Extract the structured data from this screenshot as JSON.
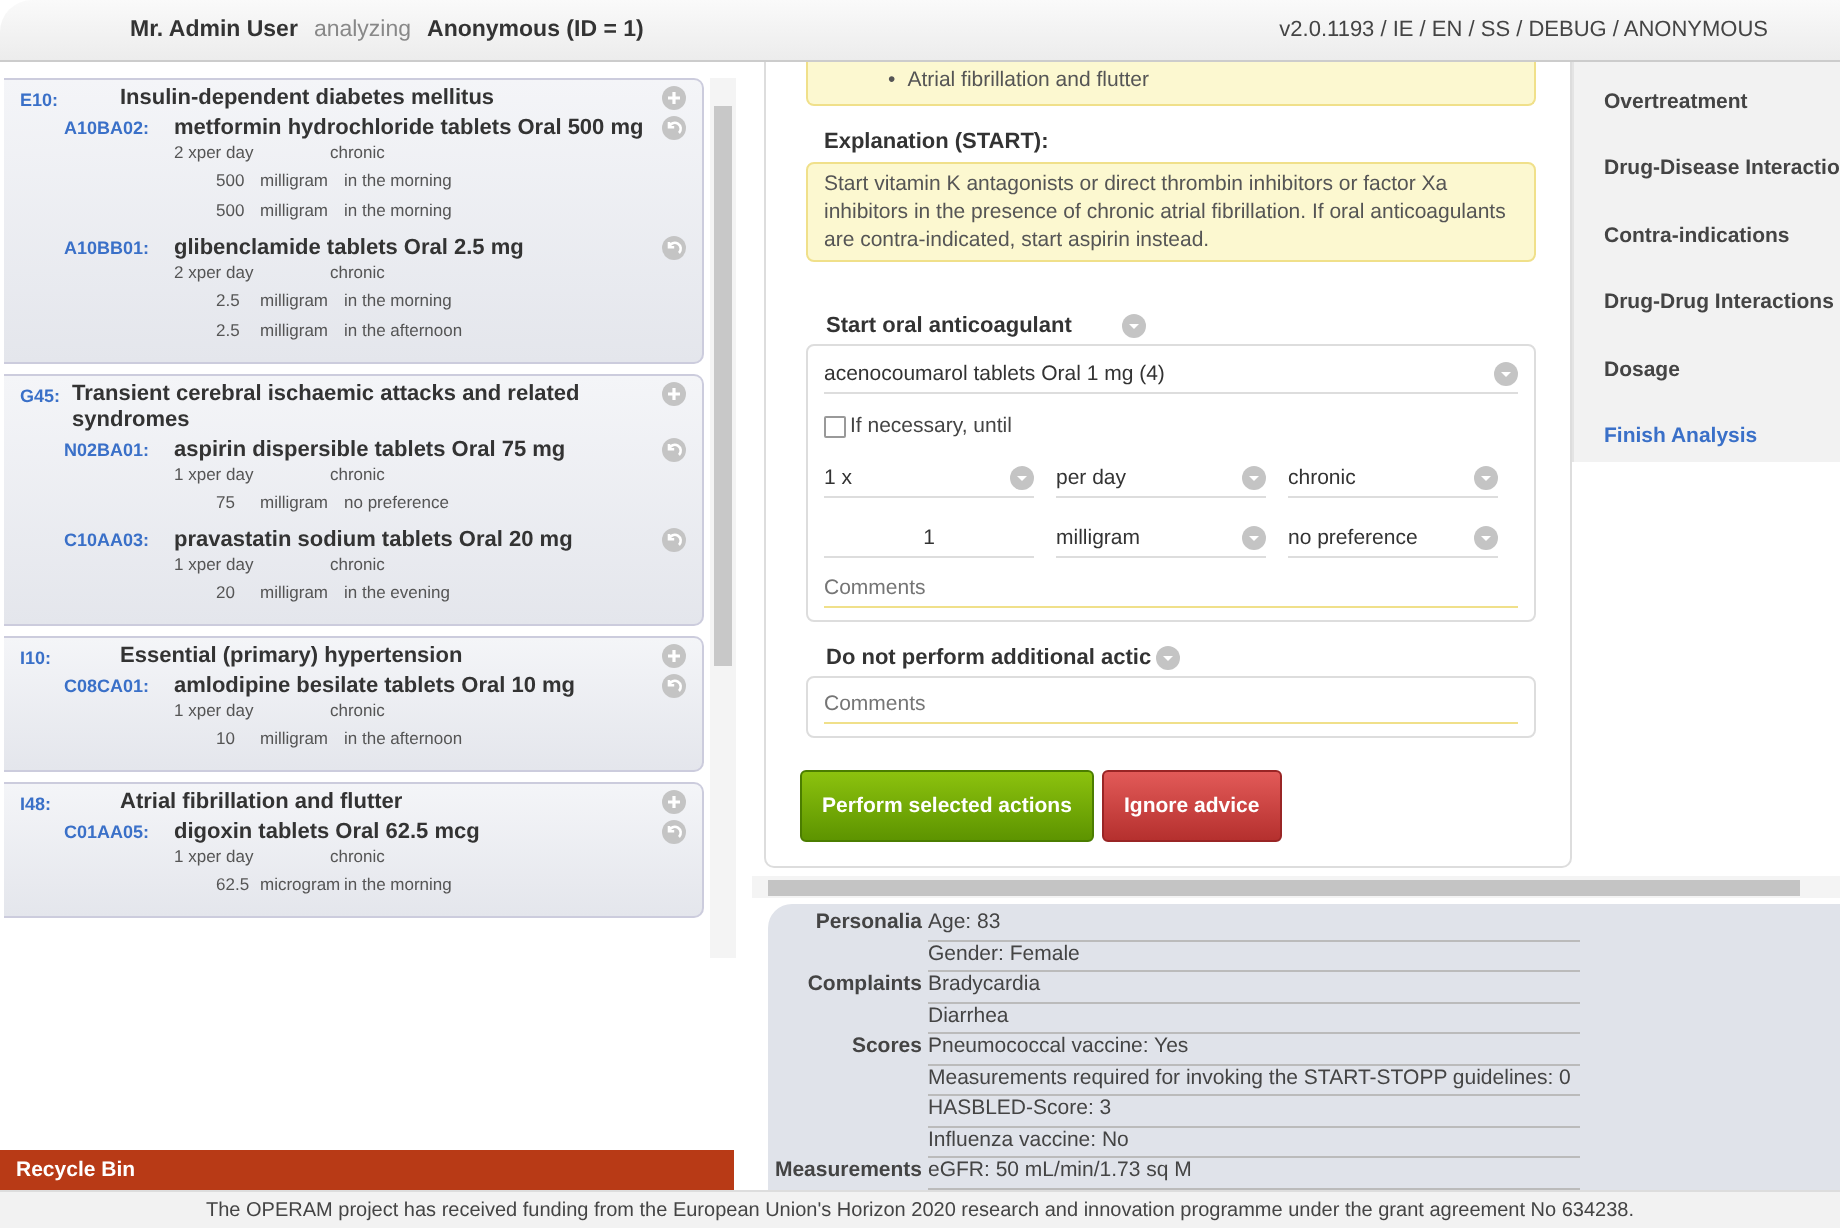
{
  "header": {
    "user": "Mr. Admin User",
    "status": "analyzing",
    "patient": "Anonymous (ID = 1)",
    "version": "v2.0.1193 / IE / EN / SS / DEBUG / ANONYMOUS"
  },
  "diagnoses": [
    {
      "code": "E10:",
      "name": "Insulin-dependent diabetes mellitus",
      "drugs": [
        {
          "code": "A10BA02:",
          "name": "metformin hydrochloride tablets Oral 500 mg",
          "frequency": "2 xper day",
          "duration": "chronic",
          "doses": [
            {
              "amount": "500",
              "unit": "milligram",
              "time": "in the morning"
            },
            {
              "amount": "500",
              "unit": "milligram",
              "time": "in the morning"
            }
          ]
        },
        {
          "code": "A10BB01:",
          "name": "glibenclamide tablets Oral 2.5 mg",
          "frequency": "2 xper day",
          "duration": "chronic",
          "doses": [
            {
              "amount": "2.5",
              "unit": "milligram",
              "time": "in the morning"
            },
            {
              "amount": "2.5",
              "unit": "milligram",
              "time": "in the afternoon"
            }
          ]
        }
      ]
    },
    {
      "code": "G45:",
      "name": "Transient cerebral ischaemic attacks and related syndromes",
      "drugs": [
        {
          "code": "N02BA01:",
          "name": "aspirin dispersible tablets Oral 75 mg",
          "frequency": "1 xper day",
          "duration": "chronic",
          "doses": [
            {
              "amount": "75",
              "unit": "milligram",
              "time": "no preference"
            }
          ]
        },
        {
          "code": "C10AA03:",
          "name": "pravastatin sodium tablets Oral 20 mg",
          "frequency": "1 xper day",
          "duration": "chronic",
          "doses": [
            {
              "amount": "20",
              "unit": "milligram",
              "time": "in the evening"
            }
          ]
        }
      ]
    },
    {
      "code": "I10:",
      "name": "Essential (primary) hypertension",
      "drugs": [
        {
          "code": "C08CA01:",
          "name": "amlodipine besilate tablets Oral 10 mg",
          "frequency": "1 xper day",
          "duration": "chronic",
          "doses": [
            {
              "amount": "10",
              "unit": "milligram",
              "time": "in the afternoon"
            }
          ]
        }
      ]
    },
    {
      "code": "I48:",
      "name": "Atrial fibrillation and flutter",
      "drugs": [
        {
          "code": "C01AA05:",
          "name": "digoxin tablets Oral 62.5 mcg",
          "frequency": "1 xper day",
          "duration": "chronic",
          "doses": [
            {
              "amount": "62.5",
              "unit": "microgram",
              "time": "in the morning"
            }
          ]
        }
      ]
    }
  ],
  "recycle_bin": "Recycle Bin",
  "advice": {
    "bullets": [
      {
        "marker": "•",
        "text": "Atrial fibrillation and flutter"
      }
    ],
    "explanation_title": "Explanation (START):",
    "explanation": "Start vitamin K antagonists or direct thrombin inhibitors or factor Xa inhibitors in the presence of chronic atrial fibrillation. If oral anticoagulants are contra-indicated, start aspirin instead."
  },
  "action_start": {
    "title": "Start oral anticoagulant",
    "medication": "acenocoumarol tablets Oral 1 mg (4)",
    "if_necessary": {
      "label": "If necessary, until",
      "checked": false
    },
    "frequency": "1 x",
    "period": "per day",
    "duration": "chronic",
    "amount": "1",
    "unit": "milligram",
    "timing": "no preference",
    "comments_placeholder": "Comments"
  },
  "action_none": {
    "title": "Do not perform additional actic",
    "comments_placeholder": "Comments"
  },
  "buttons": {
    "perform": "Perform selected actions",
    "ignore": "Ignore advice"
  },
  "nav": [
    {
      "label": "Overtreatment",
      "selected": false
    },
    {
      "label": "Drug-Disease Interactio",
      "selected": false
    },
    {
      "label": "Contra-indications",
      "selected": false
    },
    {
      "label": "Drug-Drug Interactions",
      "selected": false
    },
    {
      "label": "Dosage",
      "selected": false
    },
    {
      "label": "Finish Analysis",
      "selected": true
    }
  ],
  "patient": [
    {
      "label": "Personalia",
      "items": [
        "Age: 83",
        "Gender: Female"
      ]
    },
    {
      "label": "Complaints",
      "items": [
        "Bradycardia",
        "Diarrhea"
      ]
    },
    {
      "label": "Scores",
      "items": [
        "Pneumococcal vaccine: Yes",
        "Measurements required for invoking the START-STOPP guidelines: 0",
        "HASBLED-Score: 3",
        "Influenza vaccine: No"
      ]
    },
    {
      "label": "Measurements",
      "items": [
        "eGFR: 50 mL/min/1.73 sq M"
      ]
    }
  ],
  "footer": "The OPERAM project has received funding from the European Union's Horizon 2020 research and innovation programme under the grant agreement No 634238."
}
